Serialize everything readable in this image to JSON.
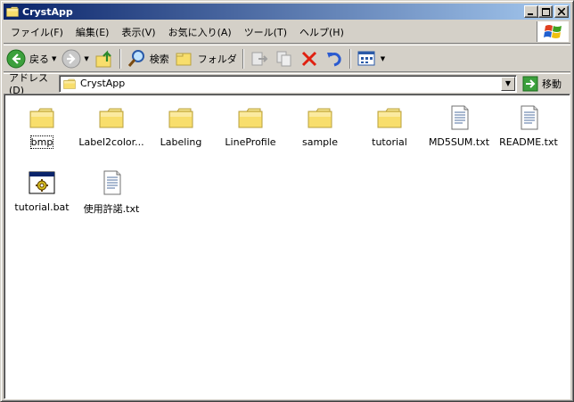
{
  "window": {
    "title": "CrystApp"
  },
  "menu": [
    "ファイル(F)",
    "編集(E)",
    "表示(V)",
    "お気に入り(A)",
    "ツール(T)",
    "ヘルプ(H)"
  ],
  "toolbar": {
    "back": "戻る",
    "search": "検索",
    "folders": "フォルダ"
  },
  "address": {
    "label": "アドレス(D)",
    "value": "CrystApp",
    "go": "移動"
  },
  "files": [
    {
      "name": "bmp",
      "type": "folder"
    },
    {
      "name": "Label2color...",
      "type": "folder"
    },
    {
      "name": "Labeling",
      "type": "folder"
    },
    {
      "name": "LineProfile",
      "type": "folder"
    },
    {
      "name": "sample",
      "type": "folder"
    },
    {
      "name": "tutorial",
      "type": "folder"
    },
    {
      "name": "MD5SUM.txt",
      "type": "text"
    },
    {
      "name": "README.txt",
      "type": "text"
    },
    {
      "name": "tutorial.bat",
      "type": "batch"
    },
    {
      "name": "使用許諾.txt",
      "type": "text"
    }
  ]
}
